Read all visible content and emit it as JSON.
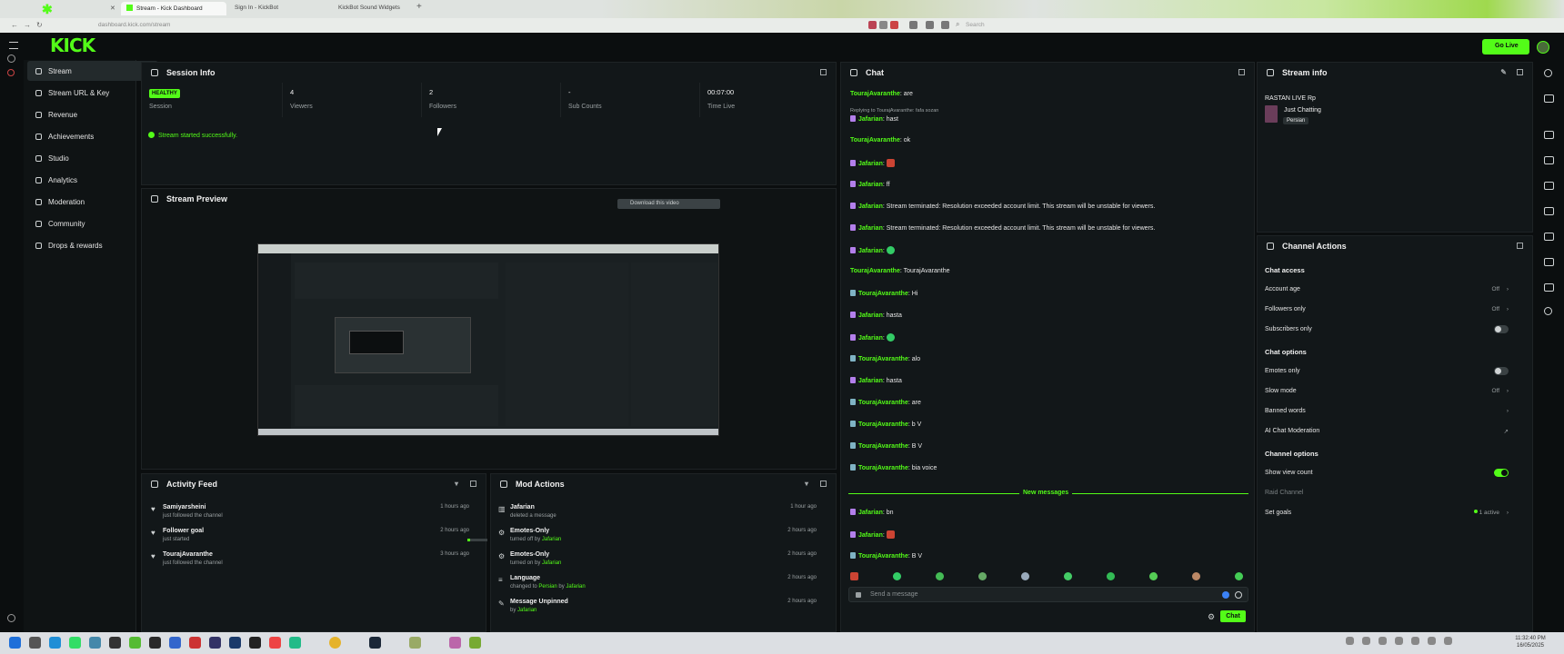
{
  "browser": {
    "tabs": [
      {
        "label": "Stream - Kick Dashboard",
        "active": true
      },
      {
        "label": "Sign In - KickBot",
        "active": false
      },
      {
        "label": "KickBot Sound Widgets",
        "active": false
      }
    ],
    "url": "dashboard.kick.com/stream",
    "search_placeholder": "Search"
  },
  "app": {
    "logo": "KICK",
    "go_live_label": "Go Live",
    "accent_color": "#53fc18"
  },
  "sidebar": {
    "items": [
      {
        "label": "Stream",
        "active": true,
        "expandable": false
      },
      {
        "label": "Stream URL & Key",
        "active": false,
        "expandable": false
      },
      {
        "label": "Revenue",
        "active": false,
        "expandable": false
      },
      {
        "label": "Achievements",
        "active": false,
        "expandable": false
      },
      {
        "label": "Studio",
        "active": false,
        "expandable": true
      },
      {
        "label": "Analytics",
        "active": false,
        "expandable": true
      },
      {
        "label": "Moderation",
        "active": false,
        "expandable": false
      },
      {
        "label": "Community",
        "active": false,
        "expandable": true
      },
      {
        "label": "Drops & rewards",
        "active": false,
        "expandable": false
      }
    ]
  },
  "session": {
    "title": "Session Info",
    "health_badge": "HEALTHY",
    "session_label": "Session",
    "viewers_value": "4",
    "viewers_label": "Viewers",
    "followers_value": "2",
    "followers_label": "Followers",
    "subcounts_value": "-",
    "subcounts_label": "Sub Counts",
    "time_value": "00:07:00",
    "time_label": "Time Live",
    "status_message": "Stream started successfully."
  },
  "preview": {
    "title": "Stream Preview",
    "download_label": "Download this video"
  },
  "activity": {
    "title": "Activity Feed",
    "items": [
      {
        "name": "Samiyarsheini",
        "sub": "just followed the channel",
        "time": "1 hours ago"
      },
      {
        "name": "Follower goal",
        "sub": "just started",
        "time": "2 hours ago"
      },
      {
        "name": "TourajAvaranthe",
        "sub": "just followed the channel",
        "time": "3 hours ago"
      }
    ]
  },
  "mod": {
    "title": "Mod Actions",
    "items": [
      {
        "name": "Jafarian",
        "sub_pre": "deleted a message",
        "sub_hl": "",
        "sub_mid": "",
        "sub_hl2": "",
        "time": "1 hour ago"
      },
      {
        "name": "Emotes-Only",
        "sub_pre": "turned off by ",
        "sub_hl": "Jafarian",
        "sub_mid": "",
        "sub_hl2": "",
        "time": "2 hours ago"
      },
      {
        "name": "Emotes-Only",
        "sub_pre": "turned on by ",
        "sub_hl": "Jafarian",
        "sub_mid": "",
        "sub_hl2": "",
        "time": "2 hours ago"
      },
      {
        "name": "Language",
        "sub_pre": "changed to ",
        "sub_hl": "Persian",
        "sub_mid": " by ",
        "sub_hl2": "Jafarian",
        "time": "2 hours ago"
      },
      {
        "name": "Message Unpinned",
        "sub_pre": "by ",
        "sub_hl": "Jafarian",
        "sub_mid": "",
        "sub_hl2": "",
        "time": "2 hours ago"
      }
    ]
  },
  "chat": {
    "title": "Chat",
    "reply_note": "Replying to TourajAvaranthe: fafa sozan",
    "messages": [
      {
        "user": "TourajAvaranthe",
        "text": "are",
        "badge": "none",
        "emote": ""
      },
      {
        "user": "Jafarian",
        "text": "hast",
        "badge": "mod",
        "emote": ""
      },
      {
        "user": "TourajAvaranthe",
        "text": "ok",
        "badge": "none",
        "emote": ""
      },
      {
        "user": "Jafarian",
        "text": "",
        "badge": "mod",
        "emote": "red"
      },
      {
        "user": "Jafarian",
        "text": "ff",
        "badge": "mod",
        "emote": ""
      },
      {
        "user": "Jafarian",
        "text": "Stream terminated: Resolution exceeded account limit. This stream will be unstable for viewers.",
        "badge": "mod",
        "emote": ""
      },
      {
        "user": "Jafarian",
        "text": "Stream terminated: Resolution exceeded account limit. This stream will be unstable for viewers.",
        "badge": "mod",
        "emote": ""
      },
      {
        "user": "Jafarian",
        "text": "",
        "badge": "mod",
        "emote": "green"
      },
      {
        "user": "TourajAvaranthe",
        "text": "TourajAvaranthe",
        "badge": "none",
        "emote": ""
      },
      {
        "user": "TourajAvaranthe",
        "text": "Hi",
        "badge": "vip",
        "emote": ""
      },
      {
        "user": "Jafarian",
        "text": "hasta",
        "badge": "mod",
        "emote": ""
      },
      {
        "user": "Jafarian",
        "text": "",
        "badge": "mod",
        "emote": "green"
      },
      {
        "user": "TourajAvaranthe",
        "text": "alo",
        "badge": "vip",
        "emote": ""
      },
      {
        "user": "Jafarian",
        "text": "hasta",
        "badge": "mod",
        "emote": ""
      },
      {
        "user": "TourajAvaranthe",
        "text": "are",
        "badge": "vip",
        "emote": ""
      },
      {
        "user": "TourajAvaranthe",
        "text": "b V",
        "badge": "vip",
        "emote": ""
      },
      {
        "user": "TourajAvaranthe",
        "text": "B V",
        "badge": "vip",
        "emote": ""
      },
      {
        "user": "TourajAvaranthe",
        "text": "bia voice",
        "badge": "vip",
        "emote": ""
      }
    ],
    "new_messages_label": "New messages",
    "new_messages": [
      {
        "user": "Jafarian",
        "text": "bn",
        "badge": "mod",
        "emote": ""
      },
      {
        "user": "Jafarian",
        "text": "",
        "badge": "mod",
        "emote": "red"
      },
      {
        "user": "TourajAvaranthe",
        "text": "B V",
        "badge": "vip",
        "emote": ""
      }
    ],
    "input_placeholder": "Send a message",
    "send_label": "Chat"
  },
  "stream_info": {
    "title": "Stream info",
    "stream_title": "RASTAN LIVE Rp",
    "category": "Just Chatting",
    "language_tag": "Persian"
  },
  "channel_actions": {
    "title": "Channel Actions",
    "chat_access_heading": "Chat access",
    "account_age_label": "Account age",
    "account_age_value": "Off",
    "followers_only_label": "Followers only",
    "followers_only_value": "Off",
    "subscribers_only_label": "Subscribers only",
    "chat_options_heading": "Chat options",
    "emotes_only_label": "Emotes only",
    "slow_mode_label": "Slow mode",
    "slow_mode_value": "Off",
    "banned_words_label": "Banned words",
    "ai_moderation_label": "AI Chat Moderation",
    "channel_options_heading": "Channel options",
    "show_view_count_label": "Show view count",
    "raid_channel_label": "Raid Channel",
    "set_goals_label": "Set goals",
    "set_goals_value": "1 active"
  },
  "system": {
    "clock_time": "11:32:40 PM",
    "clock_date": "16/05/2025"
  }
}
